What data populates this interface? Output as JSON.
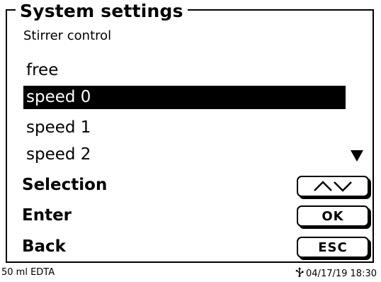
{
  "header": {
    "title": "System settings",
    "subtitle": "Stirrer control"
  },
  "options": [
    {
      "label": "free",
      "selected": false
    },
    {
      "label": "speed 0",
      "selected": true
    },
    {
      "label": "speed 1",
      "selected": false
    },
    {
      "label": "speed 2",
      "selected": false
    }
  ],
  "scroll_indicator_icon": "triangle-down-icon",
  "actions": {
    "selection": {
      "label": "Selection",
      "key_icon": "up-down-arrows-icon"
    },
    "enter": {
      "label": "Enter",
      "key_label": "OK"
    },
    "back": {
      "label": "Back",
      "key_label": "ESC"
    }
  },
  "status_bar": {
    "reagent": "50 ml EDTA",
    "usb_icon": "usb-icon",
    "datetime": "04/17/19 18:30"
  }
}
